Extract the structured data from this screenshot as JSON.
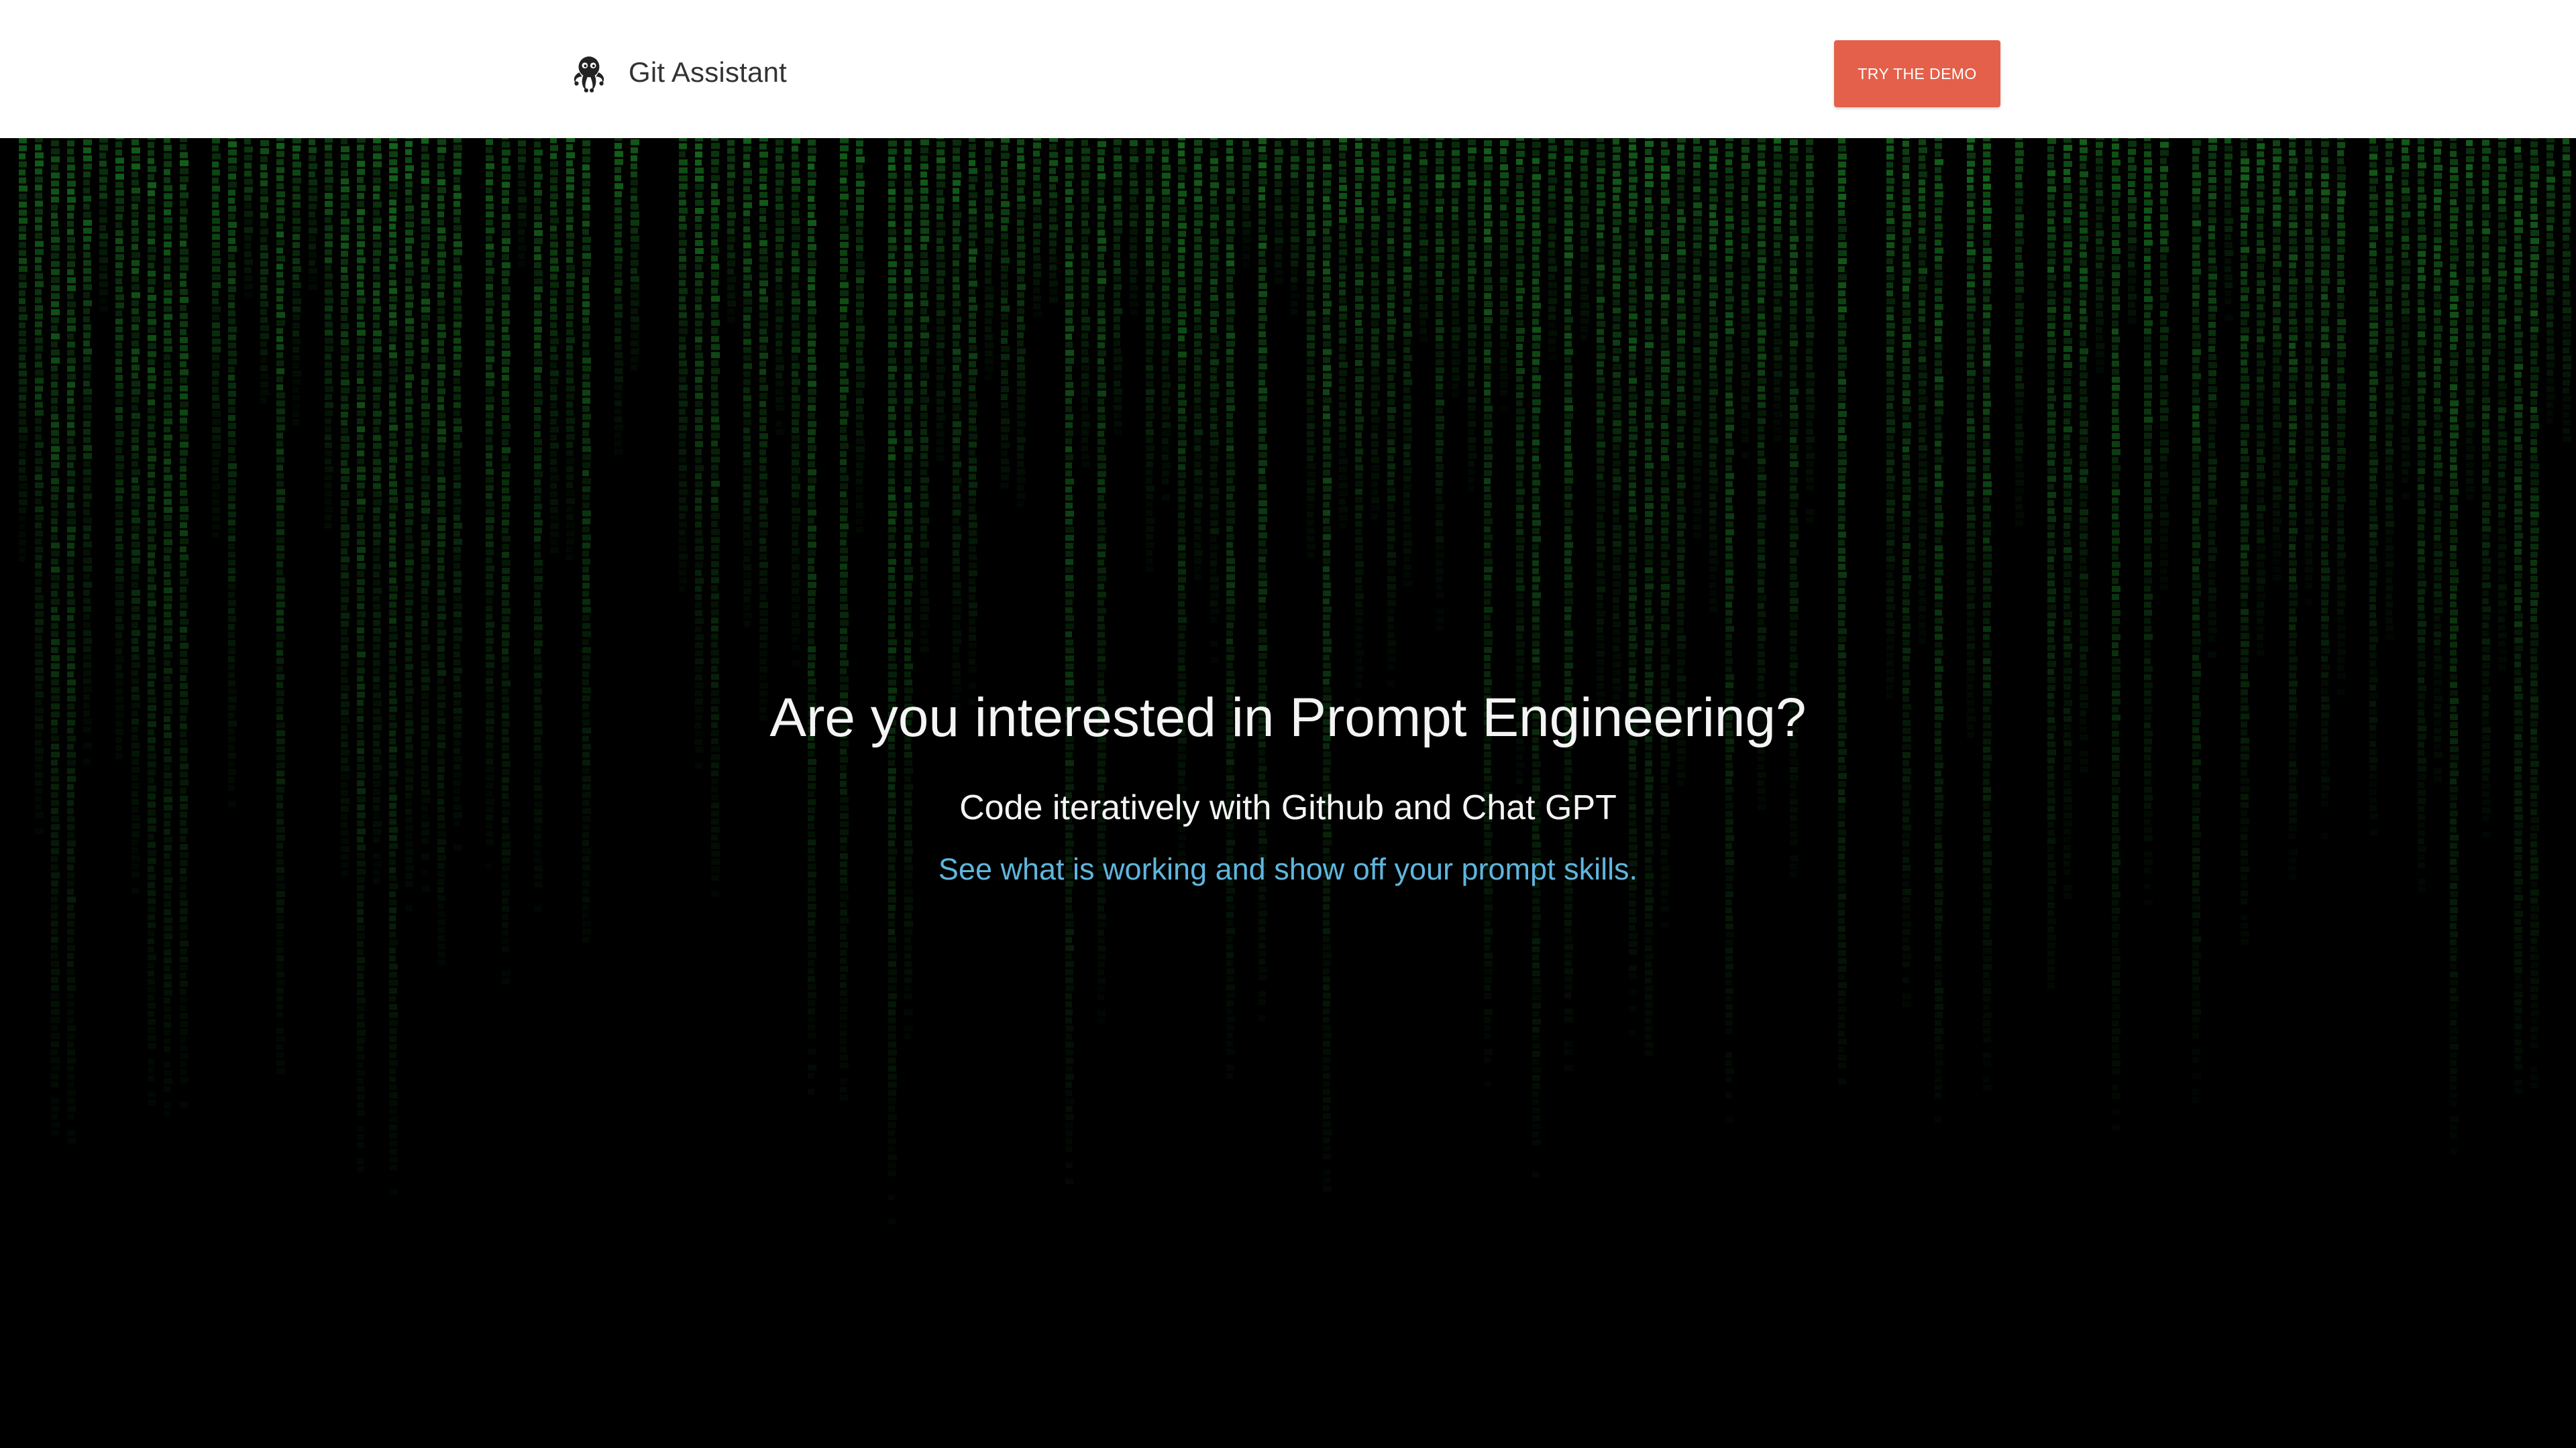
{
  "navbar": {
    "brand_name": "Git Assistant",
    "logo_icon": "octopus-icon",
    "cta_label": "TRY THE DEMO"
  },
  "hero": {
    "headline": "Are you interested in Prompt Engineering?",
    "subheadline": "Code iteratively with Github and Chat GPT",
    "tagline": "See what is working and show off your prompt skills.",
    "background": "matrix-code-rain"
  },
  "colors": {
    "navbar_bg": "#ffffff",
    "hero_bg": "#000000",
    "cta_bg": "#e4604a",
    "headline_text": "#f4f4f4",
    "tagline_text": "#5fb6dd",
    "rain_green": "#1f9a2a"
  }
}
